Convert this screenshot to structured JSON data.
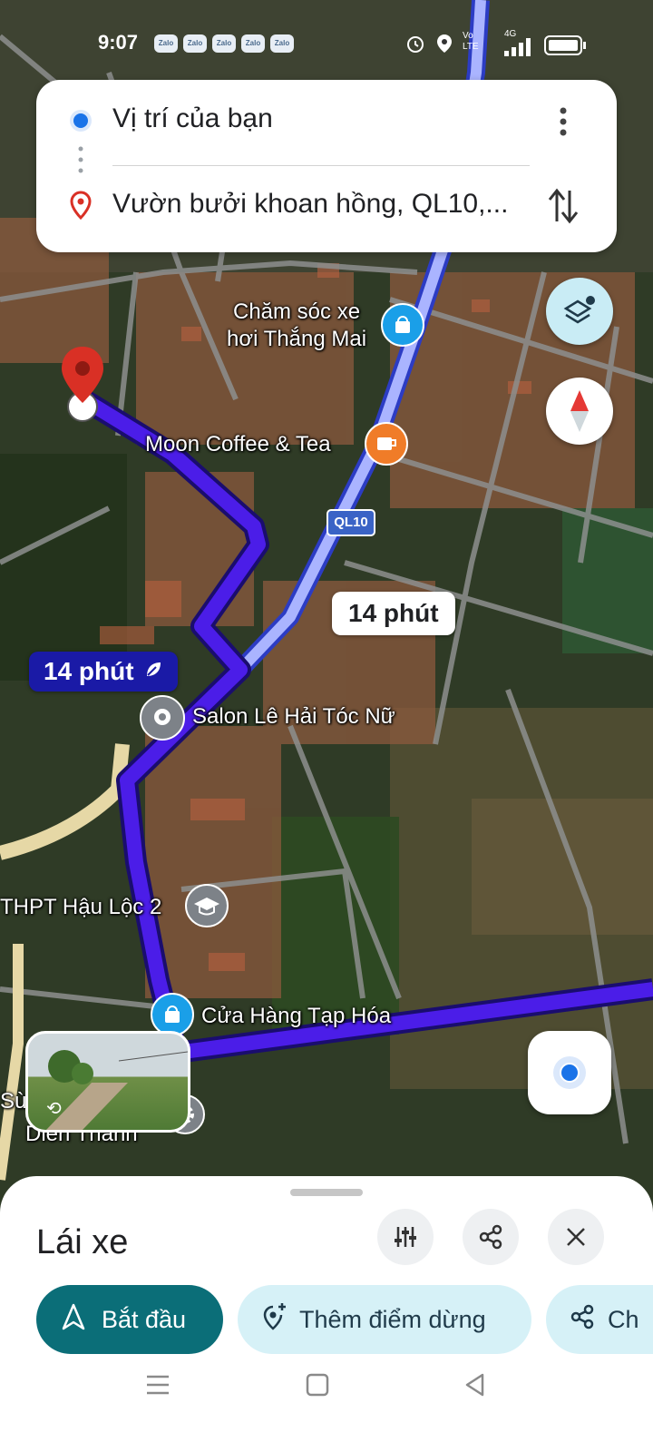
{
  "status_bar": {
    "time": "9:07",
    "notification_apps": [
      "Zalo",
      "Zalo",
      "Zalo",
      "Zalo",
      "Zalo"
    ],
    "network_label": "4G",
    "volte_label": "Vo LTE"
  },
  "route_card": {
    "origin": "Vị trí của bạn",
    "destination": "Vườn bưởi khoan hồng, QL10,..."
  },
  "map": {
    "road_shield": "QL10",
    "primary_route_time": "14 phút",
    "alternate_route_time": "14 phút",
    "pois": {
      "car_care": [
        "Chăm sóc xe",
        "hơi Thắng Mai"
      ],
      "coffee": "Moon Coffee & Tea",
      "salon": "Salon Lê Hải Tóc Nữ",
      "school": "THPT Hậu Lộc 2",
      "grocery": "Cửa Hàng Tạp Hóa",
      "partial_left": "Sù",
      "dien_thanh": "Diên Thành"
    }
  },
  "bottom_sheet": {
    "mode_title": "Lái xe",
    "start_label": "Bắt đầu",
    "add_stop_label": "Thêm điểm dừng",
    "share_partial_label": "Ch"
  },
  "colors": {
    "route_primary": "#4b1de8",
    "route_alternate": "#aab4ff",
    "start_button": "#0b6e78",
    "chip_background": "#d6f1f7",
    "location_blue": "#1a73e8",
    "destination_pin": "#d93025"
  },
  "icons": {
    "menu": "more-vert-icon",
    "swap": "swap-vertical-icon",
    "layers": "layers-icon",
    "compass": "compass-icon",
    "my_location": "my-location-icon",
    "filter": "tune-icon",
    "share": "share-icon",
    "close": "close-icon"
  }
}
